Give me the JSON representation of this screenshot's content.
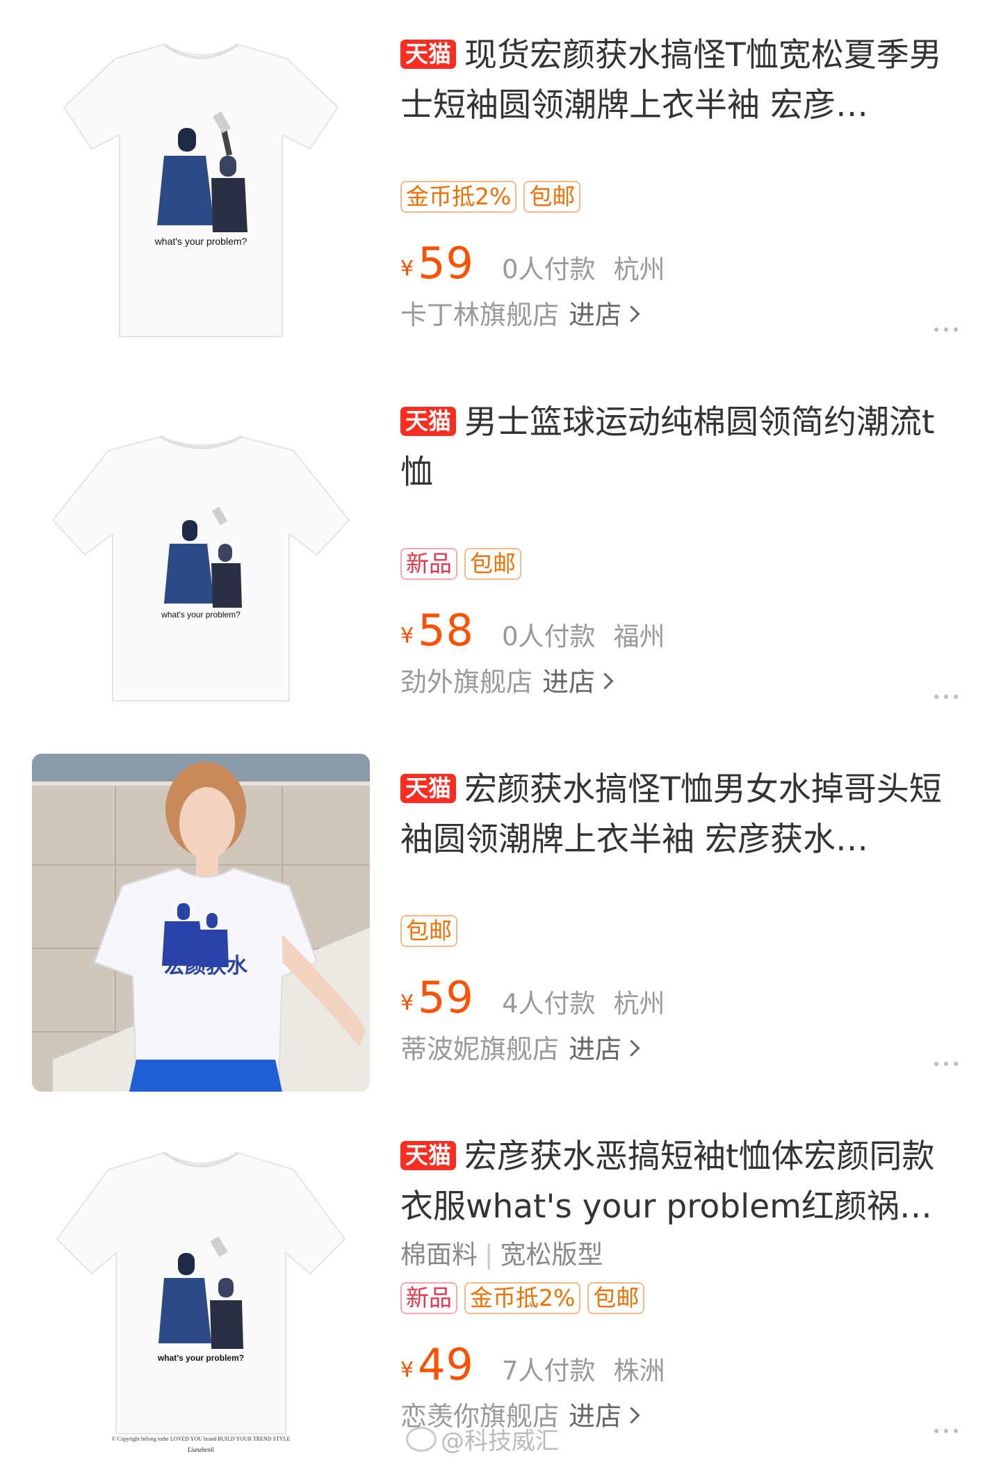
{
  "products": [
    {
      "badge": "天猫",
      "title": "现货宏颜获水搞怪T恤宽松夏季男士短袖圆领潮牌上衣半袖 宏彦…",
      "specs": [],
      "tags": [
        {
          "label": "金币抵2%",
          "color": "orange"
        },
        {
          "label": "包邮",
          "color": "orange"
        }
      ],
      "currency": "¥",
      "price": "59",
      "sales": "0人付款",
      "location": "杭州",
      "store": "卡丁林旗舰店",
      "enter_label": "进店",
      "image": {
        "print_text": "what's your problem?"
      }
    },
    {
      "badge": "天猫",
      "title": "男士篮球运动纯棉圆领简约潮流t恤",
      "specs": [],
      "tags": [
        {
          "label": "新品",
          "color": "red"
        },
        {
          "label": "包邮",
          "color": "orange"
        }
      ],
      "currency": "¥",
      "price": "58",
      "sales": "0人付款",
      "location": "福州",
      "store": "劲外旗舰店",
      "enter_label": "进店",
      "image": {
        "print_text": "what's your problem?"
      }
    },
    {
      "badge": "天猫",
      "title": "宏颜获水搞怪T恤男女水掉哥头短袖圆领潮牌上衣半袖 宏彦获水…",
      "specs": [],
      "tags": [
        {
          "label": "包邮",
          "color": "orange"
        }
      ],
      "currency": "¥",
      "price": "59",
      "sales": "4人付款",
      "location": "杭州",
      "store": "蒂波妮旗舰店",
      "enter_label": "进店",
      "image": {
        "print_text": "宏颜获水"
      }
    },
    {
      "badge": "天猫",
      "title": "宏彦获水恶搞短袖t恤体宏颜同款衣服what's your problem红颜祸…",
      "specs": [
        "棉面料",
        "宽松版型"
      ],
      "tags": [
        {
          "label": "新品",
          "color": "red"
        },
        {
          "label": "金币抵2%",
          "color": "orange"
        },
        {
          "label": "包邮",
          "color": "orange"
        }
      ],
      "currency": "¥",
      "price": "49",
      "sales": "7人付款",
      "location": "株洲",
      "store": "恋羡你旗舰店",
      "enter_label": "进店",
      "image": {
        "print_text": "what's your problem?",
        "footer_text": "© Copyright belong tothe LOVED YOU brand BUILD YOUR TREND STYLE",
        "signature": "Lianzhenli"
      }
    }
  ],
  "watermark": "@科技威汇",
  "colors": {
    "price": "#ff5000",
    "tmall": "#ff2d1f",
    "tag_orange": "#f26f00",
    "tag_red": "#e8364b"
  }
}
